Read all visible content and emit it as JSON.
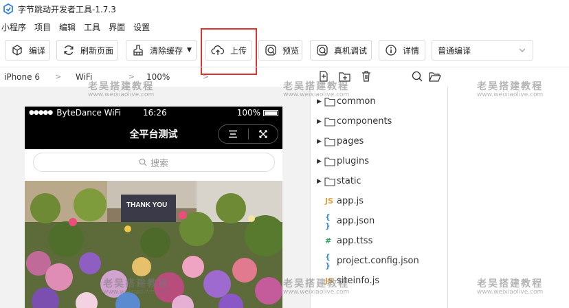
{
  "window": {
    "title": "字节跳动开发者工具-1.7.3"
  },
  "menubar": {
    "items": [
      "小程序",
      "项目",
      "编辑",
      "工具",
      "界面",
      "设置"
    ]
  },
  "toolbar": {
    "compile_label": "编译",
    "refresh_label": "刷新页面",
    "clear_cache_label": "清除缓存",
    "upload_label": "上传",
    "preview_label": "预览",
    "remote_debug_label": "真机调试",
    "details_label": "详情",
    "compile_mode_value": "普通编译"
  },
  "device_bar": {
    "device": "iPhone 6",
    "network": "WiFi",
    "zoom": "100%"
  },
  "simulator": {
    "carrier": "ByteDance WiFi",
    "time": "16:26",
    "battery": "100%",
    "page_title": "全平台测试",
    "search_placeholder": "搜索",
    "banner_text": "THANK YOU"
  },
  "file_tree": {
    "items": [
      {
        "type": "folder",
        "name": "common"
      },
      {
        "type": "folder",
        "name": "components"
      },
      {
        "type": "folder",
        "name": "pages"
      },
      {
        "type": "folder",
        "name": "plugins"
      },
      {
        "type": "folder",
        "name": "static"
      },
      {
        "type": "js",
        "icon_text": "JS",
        "name": "app.js"
      },
      {
        "type": "json",
        "icon_text": "{ }",
        "name": "app.json"
      },
      {
        "type": "ttss",
        "icon_text": "#",
        "name": "app.ttss"
      },
      {
        "type": "json",
        "icon_text": "{ }",
        "name": "project.config.json"
      },
      {
        "type": "js",
        "icon_text": "JS",
        "name": "siteinfo.js"
      }
    ]
  },
  "watermark": {
    "text": "老吴搭建教程",
    "url": "www.weixiaolive.com"
  },
  "colors": {
    "highlight": "#e0312c",
    "js_icon": "#e2a23b",
    "json_icon": "#3d8fd6",
    "ttss_icon": "#2aa55f"
  }
}
